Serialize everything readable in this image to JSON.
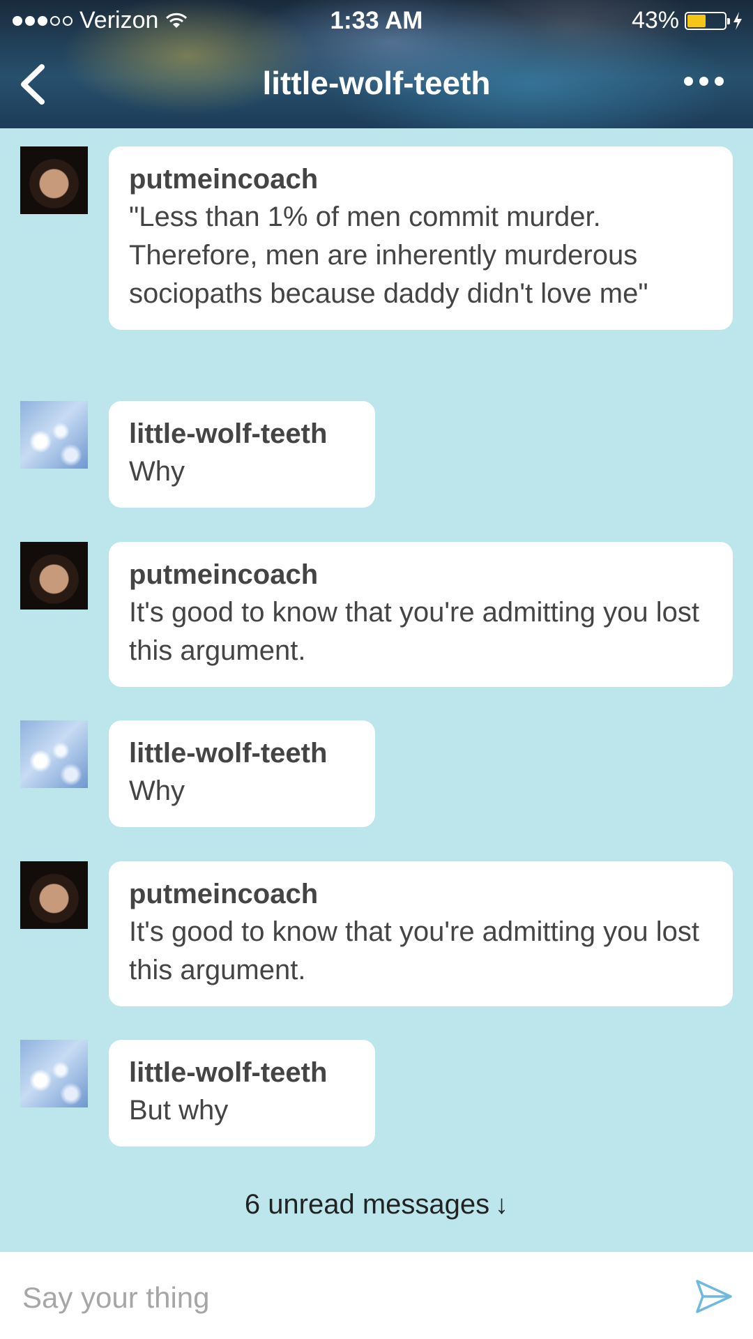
{
  "status_bar": {
    "carrier": "Verizon",
    "time": "1:33 AM",
    "battery": "43%"
  },
  "header": {
    "title": "little-wolf-teeth"
  },
  "messages": [
    {
      "sender": "putmeincoach",
      "text": "\"Less than 1% of men commit murder. Therefore, men are inherently murderous sociopaths because daddy didn't love me\""
    },
    {
      "sender": "little-wolf-teeth",
      "text": "Why"
    },
    {
      "sender": "putmeincoach",
      "text": "It's good to know that you're admitting you lost this argument."
    },
    {
      "sender": "little-wolf-teeth",
      "text": "Why"
    },
    {
      "sender": "putmeincoach",
      "text": "It's good to know that you're admitting you lost this argument."
    },
    {
      "sender": "little-wolf-teeth",
      "text": "But why"
    }
  ],
  "unread": {
    "label": "6 unread messages",
    "arrow": "↓"
  },
  "composer": {
    "placeholder": "Say your thing"
  },
  "colors": {
    "background": "#bce6ec",
    "bubble": "#ffffff",
    "battery_fill": "#f5c518",
    "send_icon": "#6fb8de"
  }
}
